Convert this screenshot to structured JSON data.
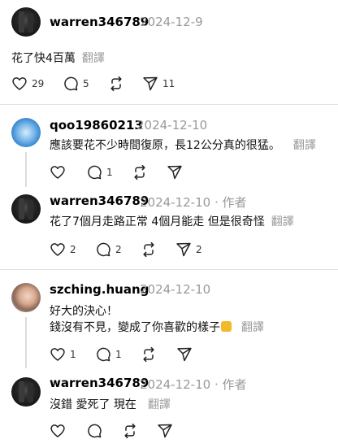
{
  "posts": [
    {
      "username": "warren346789",
      "date": "2024-12-9",
      "text": "花了快4百萬",
      "translate": "翻譯",
      "likes": "29",
      "replies": "5",
      "shares": "11"
    },
    {
      "username": "qoo19860213",
      "date": "2024-12-10",
      "text": "應該要花不少時間復原，長12公分真的很猛。",
      "translate": "翻譯",
      "replies": "1"
    },
    {
      "username": "warren346789",
      "date": "2024-12-10 · 作者",
      "text": "花了7個月走路正常 4個月能走 但是很奇怪",
      "translate": "翻譯",
      "likes": "2",
      "replies": "2",
      "shares": "2"
    },
    {
      "username": "szching.huang",
      "date": "2024-12-10",
      "line1": "好大的決心！",
      "line2": "錢沒有不見，變成了你喜歡的樣子",
      "translate": "翻譯",
      "likes": "1",
      "replies": "1"
    },
    {
      "username": "warren346789",
      "date": "2024-12-10 · 作者",
      "text": "沒錯 愛死了 現在",
      "translate": "翻譯"
    }
  ],
  "icons": [
    "heart-icon",
    "reply-icon",
    "repost-icon",
    "share-icon",
    "thumbs-up-emoji"
  ]
}
